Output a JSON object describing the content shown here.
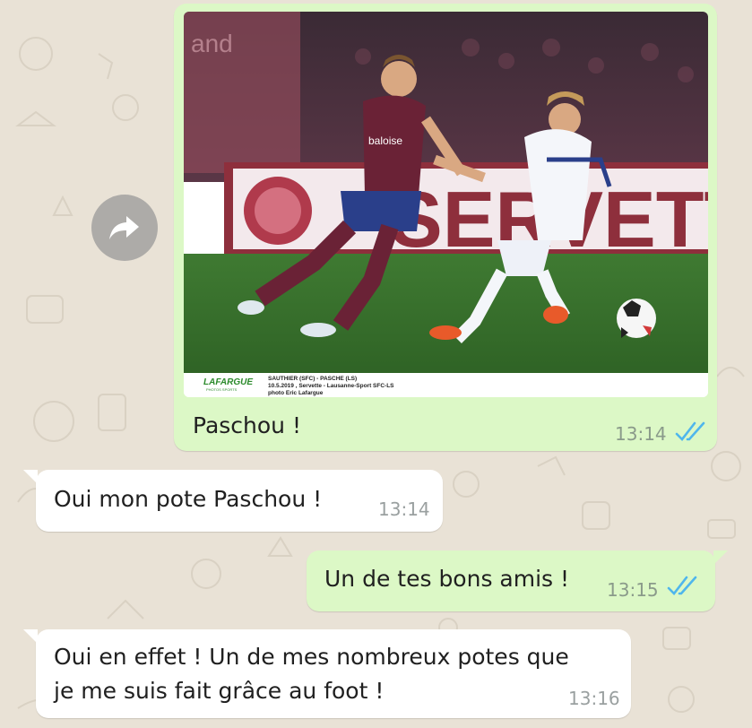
{
  "conversation": {
    "forward_icon": "forward-arrow-icon",
    "image_message": {
      "caption": "Paschou !",
      "time": "13:14",
      "status_icon": "double-check-read-icon",
      "photo": {
        "description_icon": "football-match-photo",
        "stadium_banner": "SERVETT",
        "jersey_sponsor": "baloise",
        "credit_brand": "LAFARGUE",
        "credit_brand_sub": "PHOTOS SPORTS",
        "credit_line1": "SAUTHIER (SFC) - PASCHE (LS)",
        "credit_line2": "10.5.2019 , Servette - Lausanne-Sport  SFC-LS",
        "credit_line3": "photo Eric Lafargue"
      }
    },
    "messages": [
      {
        "direction": "incoming",
        "text": "Oui mon pote Paschou !",
        "time": "13:14"
      },
      {
        "direction": "outgoing",
        "text": "Un de tes bons amis !",
        "time": "13:15",
        "status_icon": "double-check-read-icon"
      },
      {
        "direction": "incoming",
        "text_line1": "Oui en effet ! Un de mes nombreux potes que",
        "text_line2": "je me suis fait grâce au foot !",
        "time": "13:16"
      }
    ]
  },
  "colors": {
    "wallpaper": "#e9e2d6",
    "outgoing_bubble": "#dcf8c6",
    "incoming_bubble": "#ffffff",
    "read_ticks": "#4fb6ec"
  }
}
